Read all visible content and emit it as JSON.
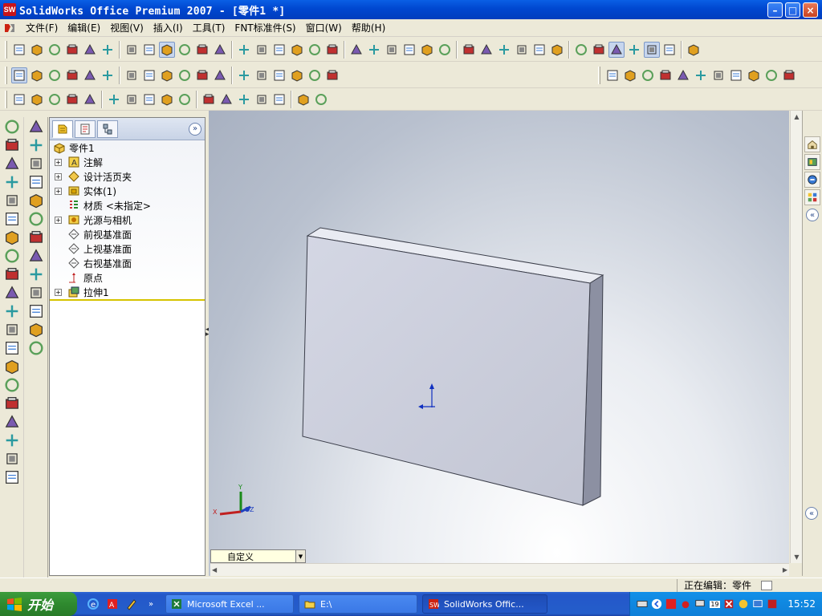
{
  "window": {
    "title": "SolidWorks Office Premium 2007 - [零件1 *]",
    "app_icon_text": "SW",
    "colors": {
      "titlebar": "#0a5fe5",
      "taskbar": "#245ecb",
      "start_button": "#2f8a2f",
      "rollback_bar": "#d6c300",
      "part_face": "#c9ccd9"
    }
  },
  "menu": {
    "items": [
      "文件(F)",
      "编辑(E)",
      "视图(V)",
      "插入(I)",
      "工具(T)",
      "FNT标准件(S)",
      "窗口(W)",
      "帮助(H)"
    ]
  },
  "toolbars": {
    "standard": [
      "new-icon",
      "open-icon",
      "save-icon",
      "print-icon",
      "print-preview-icon",
      "options-icon",
      "undo-icon",
      "redo-icon",
      "select-icon",
      "select-other-icon",
      "rebuild-icon",
      "options-grid-icon",
      "sketch-icon",
      "smart-dimension-icon",
      "display-icon",
      "hide-show-icon",
      "help-icon",
      "properties-icon",
      "redraw-icon",
      "section-icon",
      "zoom-fit-icon",
      "zoom-area-icon",
      "zoom-in-icon",
      "previous-view-icon",
      "zoom-icon",
      "rotate-icon",
      "pan-icon",
      "roll-icon",
      "view-orientation-icon",
      "front-view-icon",
      "back-view-icon",
      "left-view-icon",
      "shaded-icon",
      "hidden-lines-icon",
      "wireframe-icon",
      "shadows-icon",
      "realview-icon"
    ],
    "features": [
      "mode-icon",
      "dimension-icon",
      "extrude-icon",
      "cut-icon",
      "revolve-icon",
      "sweep-icon",
      "loft-icon",
      "fillet-icon",
      "chamfer-icon",
      "shell-icon",
      "draft-icon",
      "rib-icon",
      "wrap-icon",
      "linear-pattern-icon",
      "circular-pattern-icon",
      "mirror-icon",
      "reference-geometry-icon",
      "curves-icon"
    ],
    "views": [
      "normal-to-icon",
      "front-icon",
      "back-icon",
      "left-icon",
      "right-icon",
      "top-icon",
      "bottom-icon",
      "isometric-icon",
      "trimetric-icon",
      "dimetric-icon",
      "view-link-icon"
    ],
    "sketch": [
      "line-icon",
      "circle-icon",
      "arc-icon",
      "slot-icon",
      "centerline-icon",
      "point-icon",
      "trim-icon",
      "extend-icon",
      "offset-icon",
      "spline-icon",
      "dimension-line-icon",
      "convert-icon",
      "repair-icon",
      "mirror-sketch-icon",
      "linear-sketch-icon",
      "fix-icon",
      "smart-icon"
    ]
  },
  "feature_tree": {
    "root": "零件1",
    "items": [
      {
        "label": "注解",
        "expandable": true,
        "icon": "annotations-icon"
      },
      {
        "label": "设计活页夹",
        "expandable": true,
        "icon": "design-binder-icon"
      },
      {
        "label": "实体(1)",
        "expandable": true,
        "icon": "solid-bodies-icon"
      },
      {
        "label": "材质 <未指定>",
        "expandable": false,
        "icon": "material-icon"
      },
      {
        "label": "光源与相机",
        "expandable": true,
        "icon": "lights-cameras-icon"
      },
      {
        "label": "前视基准面",
        "expandable": false,
        "icon": "plane-icon"
      },
      {
        "label": "上视基准面",
        "expandable": false,
        "icon": "plane-icon"
      },
      {
        "label": "右视基准面",
        "expandable": false,
        "icon": "plane-icon"
      },
      {
        "label": "原点",
        "expandable": false,
        "icon": "origin-icon"
      },
      {
        "label": "拉伸1",
        "expandable": true,
        "icon": "extrude-feature-icon"
      }
    ]
  },
  "viewport": {
    "triad": {
      "x": "X",
      "y": "Y",
      "z": "Z"
    }
  },
  "config_dropdown": {
    "value": "自定义"
  },
  "statusbar": {
    "message": "正在编辑：零件"
  },
  "taskbar": {
    "start": "开始",
    "tasks": [
      {
        "label": "Microsoft Excel ...",
        "icon": "excel-icon",
        "active": false
      },
      {
        "label": "E:\\",
        "icon": "folder-icon",
        "active": false
      },
      {
        "label": "SolidWorks Offic...",
        "icon": "solidworks-icon",
        "active": true
      }
    ],
    "tray_date": "19",
    "clock": "15:52"
  }
}
